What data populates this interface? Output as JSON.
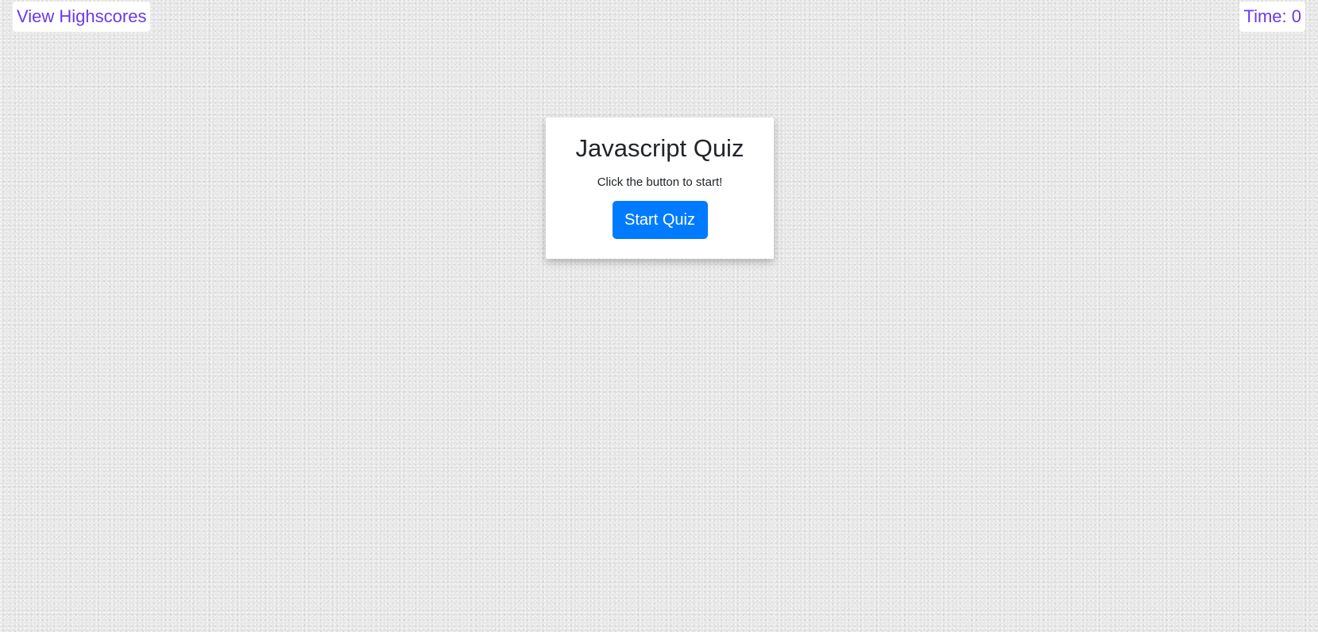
{
  "header": {
    "highscores_label": "View Highscores",
    "timer_label": "Time: 0"
  },
  "quiz": {
    "title": "Javascript Quiz",
    "subtitle": "Click the button to start!",
    "start_label": "Start Quiz"
  },
  "colors": {
    "link": "#6a38f0",
    "button": "#007bff",
    "background": "#e6e6e6",
    "card": "#ffffff"
  }
}
